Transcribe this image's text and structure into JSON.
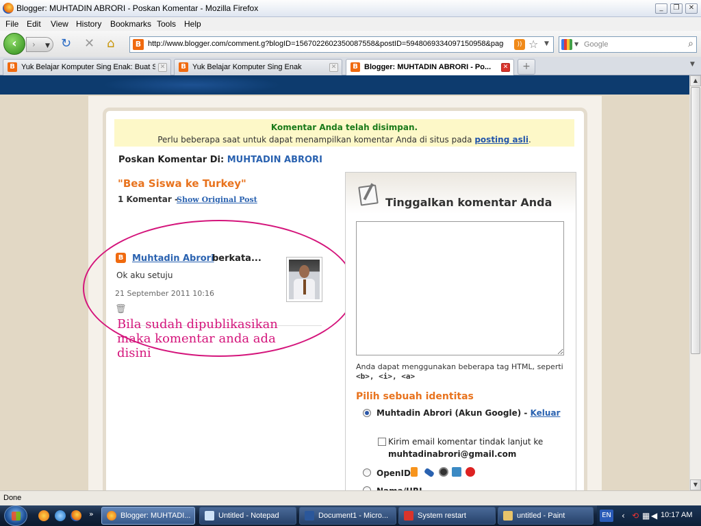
{
  "window": {
    "title": "Blogger: MUHTADIN ABRORI - Poskan Komentar - Mozilla Firefox"
  },
  "menu": {
    "items": [
      "File",
      "Edit",
      "View",
      "History",
      "Bookmarks",
      "Tools",
      "Help"
    ]
  },
  "nav": {
    "url": "http://www.blogger.com/comment.g?blogID=1567022602350087558&postID=5948069334097150958&page=",
    "search_placeholder": "Google"
  },
  "tabs": [
    {
      "label": "Yuk Belajar Komputer Sing Enak: Buat S...",
      "active": false
    },
    {
      "label": "Yuk Belajar Komputer Sing Enak",
      "active": false
    },
    {
      "label": "Blogger: MUHTADIN ABRORI - Po...",
      "active": true
    }
  ],
  "notice": {
    "saved": "Komentar Anda telah disimpan.",
    "info_prefix": "Perlu beberapa saat untuk dapat menampilkan komentar Anda di situs pada",
    "info_link": "posting asli",
    "info_suffix": "."
  },
  "post": {
    "posted_on_label": "Poskan Komentar Di:",
    "blog_name": "MUHTADIN ABRORI",
    "title": "\"Bea Siswa ke Turkey\"",
    "comment_count": "1 Komentar",
    "comment_count_sep": "-",
    "show_original": "Show Original Post"
  },
  "comment": {
    "author": "Muhtadin Abrori",
    "said": "berkata...",
    "text": "Ok aku setuju",
    "date": "21 September 2011 10:16"
  },
  "annotation": {
    "text": "Bila sudah dipublikasikan maka komentar anda ada disini",
    "color": "#d4147b"
  },
  "form": {
    "title": "Tinggalkan komentar Anda",
    "html_hint_prefix": "Anda dapat menggunakan beberapa tag HTML, seperti",
    "html_tags": "<b>, <i>, <a>",
    "identity_heading": "Pilih sebuah identitas",
    "identity_google": "Muhtadin Abrori (Akun Google) -",
    "logout": "Keluar",
    "email_followup": "Kirim email komentar tindak lanjut ke",
    "email": "muhtadinabrori@gmail.com",
    "openid": "OpenID",
    "name_url": "Nama/URL"
  },
  "status": {
    "text": "Done"
  },
  "taskbar": {
    "buttons": [
      {
        "label": "Blogger: MUHTADI...",
        "active": true
      },
      {
        "label": "Untitled - Notepad",
        "active": false
      },
      {
        "label": "Document1 - Micro...",
        "active": false
      },
      {
        "label": "System restart",
        "active": false
      },
      {
        "label": "untitled - Paint",
        "active": false
      }
    ],
    "language": "EN",
    "clock": "10:17 AM"
  }
}
